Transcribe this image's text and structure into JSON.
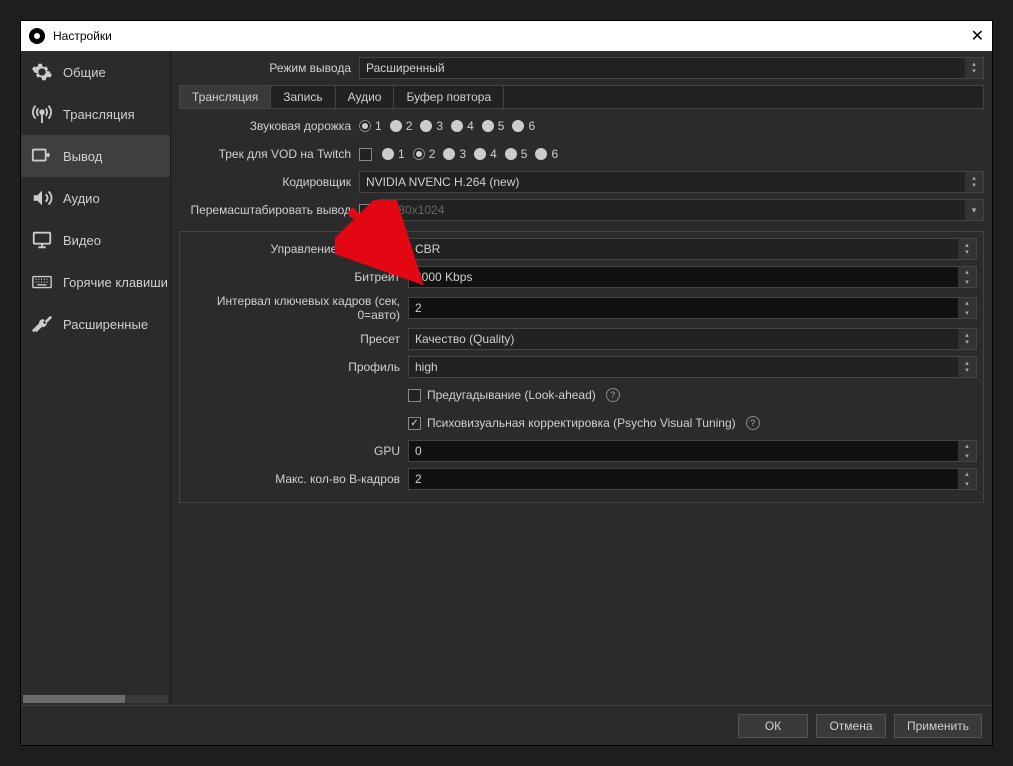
{
  "window": {
    "title": "Настройки"
  },
  "sidebar": {
    "items": [
      {
        "label": "Общие"
      },
      {
        "label": "Трансляция"
      },
      {
        "label": "Вывод"
      },
      {
        "label": "Аудио"
      },
      {
        "label": "Видео"
      },
      {
        "label": "Горячие клавиши"
      },
      {
        "label": "Расширенные"
      }
    ]
  },
  "outputMode": {
    "label": "Режим вывода",
    "value": "Расширенный"
  },
  "tabs": [
    {
      "label": "Трансляция"
    },
    {
      "label": "Запись"
    },
    {
      "label": "Аудио"
    },
    {
      "label": "Буфер повтора"
    }
  ],
  "audioTrack": {
    "label": "Звуковая дорожка",
    "options": [
      "1",
      "2",
      "3",
      "4",
      "5",
      "6"
    ],
    "selected": "1"
  },
  "vodTrack": {
    "label": "Трек для VOD на Twitch",
    "options": [
      "1",
      "2",
      "3",
      "4",
      "5",
      "6"
    ],
    "selected": "2"
  },
  "encoder": {
    "label": "Кодировщик",
    "value": "NVIDIA NVENC H.264 (new)"
  },
  "rescale": {
    "label": "Перемасштабировать вывод",
    "placeholder": "1280x1024"
  },
  "rateControl": {
    "label": "Управление битрейтом",
    "value": "CBR"
  },
  "bitrate": {
    "label": "Битрейт",
    "value": "6000 Kbps"
  },
  "keyframe": {
    "label": "Интервал ключевых кадров (сек, 0=авто)",
    "value": "2"
  },
  "preset": {
    "label": "Пресет",
    "value": "Качество (Quality)"
  },
  "profile": {
    "label": "Профиль",
    "value": "high"
  },
  "lookahead": {
    "label": "Предугадывание (Look-ahead)"
  },
  "psycho": {
    "label": "Психовизуальная корректировка (Psycho Visual Tuning)"
  },
  "gpu": {
    "label": "GPU",
    "value": "0"
  },
  "bframes": {
    "label": "Макс. кол-во B-кадров",
    "value": "2"
  },
  "footer": {
    "ok": "ОК",
    "cancel": "Отмена",
    "apply": "Применить"
  }
}
